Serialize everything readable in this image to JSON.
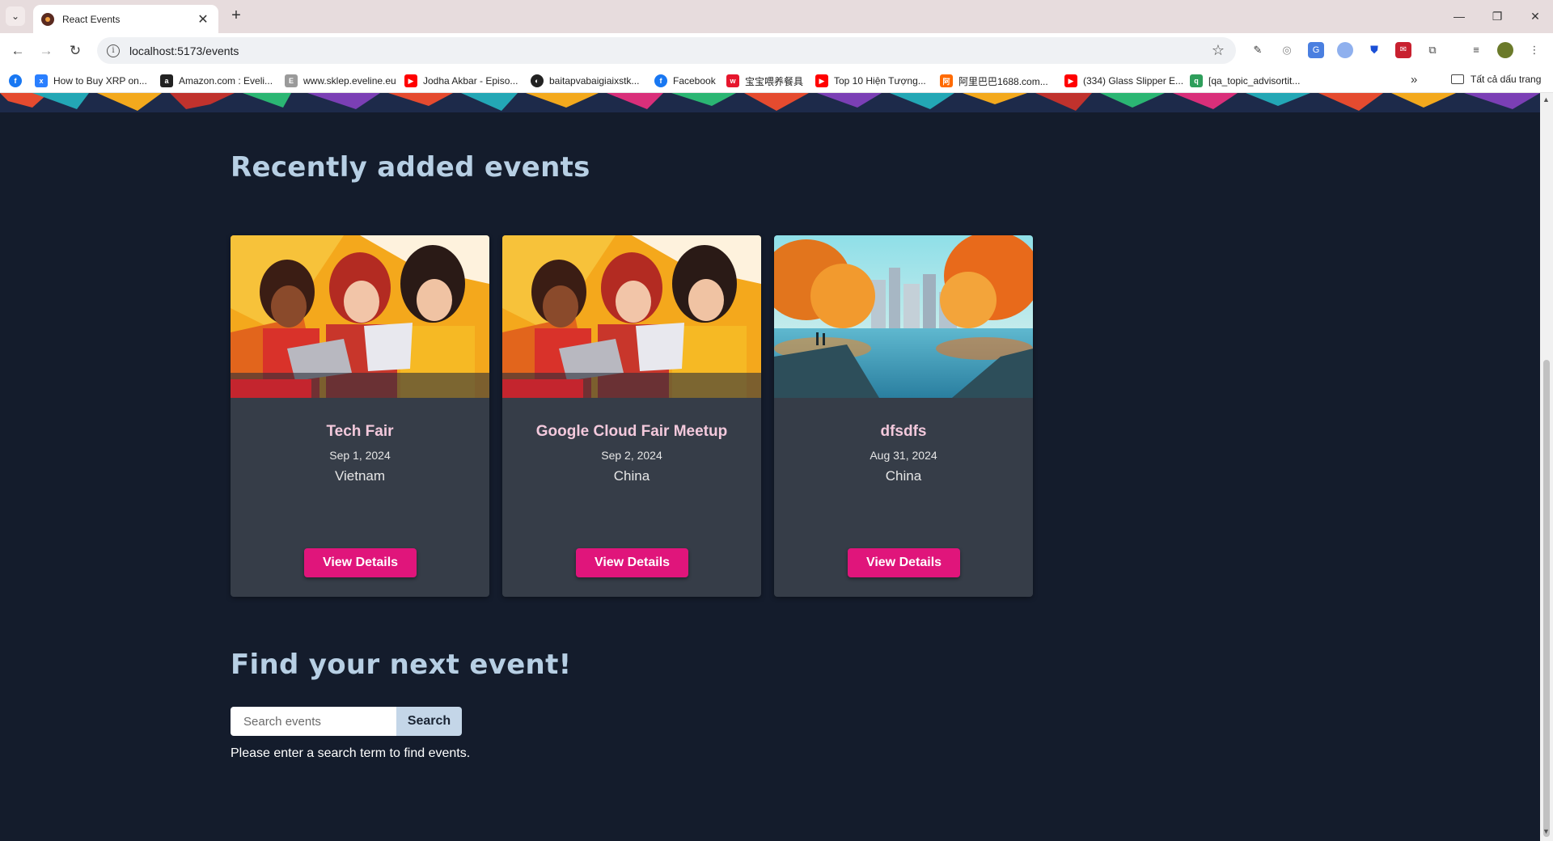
{
  "browser": {
    "tab_title": "React Events",
    "url": "localhost:5173/events",
    "bookmarks": [
      {
        "label": "",
        "icon": "facebook-icon",
        "color": "#1877f2"
      },
      {
        "label": "How to Buy XRP on...",
        "icon": "xrp-icon",
        "color": "#2a7fff"
      },
      {
        "label": "Amazon.com : Eveli...",
        "icon": "amazon-icon",
        "color": "#222222"
      },
      {
        "label": "www.sklep.eveline.eu",
        "icon": "eveline-icon",
        "color": "#8a8a8a"
      },
      {
        "label": "Jodha Akbar - Episo...",
        "icon": "youtube-icon",
        "color": "#ff0000"
      },
      {
        "label": "baitapvabaigiaixstk...",
        "icon": "site-icon",
        "color": "#222222"
      },
      {
        "label": "Facebook",
        "icon": "facebook-icon",
        "color": "#1877f2"
      },
      {
        "label": "宝宝喂养餐具",
        "icon": "weibo-icon",
        "color": "#e6162d"
      },
      {
        "label": "Top 10 Hiện Tượng...",
        "icon": "youtube-icon",
        "color": "#ff0000"
      },
      {
        "label": "阿里巴巴1688.com...",
        "icon": "alibaba-icon",
        "color": "#ff6a00"
      },
      {
        "label": "(334) Glass Slipper E...",
        "icon": "youtube-icon",
        "color": "#ff0000"
      },
      {
        "label": "[qa_topic_advisortit...",
        "icon": "qa-icon",
        "color": "#2e9e5b"
      }
    ],
    "all_bookmarks_label": "Tất cả dấu trang"
  },
  "page": {
    "recent_title": "Recently added events",
    "events": [
      {
        "title": "Tech Fair",
        "date": "Sep 1, 2024",
        "location": "Vietnam",
        "button": "View Details",
        "image": "women-laptops"
      },
      {
        "title": "Google Cloud Fair Meetup",
        "date": "Sep 2, 2024",
        "location": "China",
        "button": "View Details",
        "image": "women-laptops"
      },
      {
        "title": "dfsdfs",
        "date": "Aug 31, 2024",
        "location": "China",
        "button": "View Details",
        "image": "autumn-park"
      }
    ],
    "find_title": "Find your next event!",
    "search": {
      "placeholder": "Search events",
      "value": "",
      "button": "Search"
    },
    "search_message": "Please enter a search term to find events."
  },
  "colors": {
    "background": "#141c2c",
    "card": "#363d48",
    "accent": "#e0157b",
    "heading": "#b7cfe4",
    "card_title": "#f3c9dc"
  }
}
